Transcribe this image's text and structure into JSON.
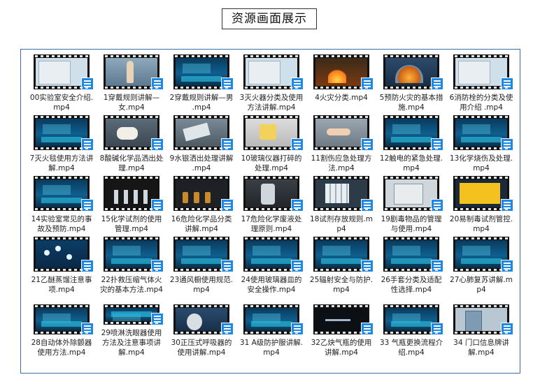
{
  "page": {
    "title": "资源画面展示"
  },
  "colors": {
    "badge": "#1e88e5",
    "window_border": "#3b6ea5"
  },
  "badge_icon": "playlist-icon",
  "files": [
    {
      "name": "00实验室安全介绍.mp4",
      "scene": "board"
    },
    {
      "name": "1穿戴规则讲解—女.mp4",
      "scene": "person"
    },
    {
      "name": "2穿戴规则讲解—男 .mp4",
      "scene": "lab"
    },
    {
      "name": "3灭火器分类及使用方法讲解.mp4",
      "scene": "board"
    },
    {
      "name": "4火灾分类.mp4",
      "scene": "fire"
    },
    {
      "name": "5预防火灾的基本措施.mp4",
      "scene": "dome"
    },
    {
      "name": "6消防栓的分类及使用介绍 .mp4",
      "scene": "board"
    },
    {
      "name": "7灭火毯使用方法讲解.mp4",
      "scene": "lab"
    },
    {
      "name": "8酸碱化学品洒出处理.mp4",
      "scene": "hand"
    },
    {
      "name": "9水银洒出处理讲解 .mp4",
      "scene": "spill"
    },
    {
      "name": "10玻璃仪器打碎的处理.mp4",
      "scene": "tube"
    },
    {
      "name": "11割伤应急处理方法.mp4",
      "scene": "cut"
    },
    {
      "name": "12触电的紧急处理.mp4",
      "scene": "lab"
    },
    {
      "name": "13化学烧伤及处理.mp4",
      "scene": "lab"
    },
    {
      "name": "14实验室常见的事故及预防.mp4",
      "scene": "lab"
    },
    {
      "name": "15化学试剂的使用管理.mp4",
      "scene": "stand"
    },
    {
      "name": "16危险化学品分类讲解.mp4",
      "scene": "bottle"
    },
    {
      "name": "17危险化学废液处理原则.mp4",
      "scene": "can"
    },
    {
      "name": "18试剂存放规则.mp4",
      "scene": "rack"
    },
    {
      "name": "19剧毒物品的管理与使用.mp4",
      "scene": "safe"
    },
    {
      "name": "20易制毒试剂管控.mp4",
      "scene": "yellow"
    },
    {
      "name": "21乙醚蒸馏注意事项.mp4",
      "scene": "molecule"
    },
    {
      "name": "22扑救压缩气体火灾的基本方法.mp4",
      "scene": "lab"
    },
    {
      "name": "23通风橱使用规范.mp4",
      "scene": "lab"
    },
    {
      "name": "24使用玻璃器皿的安全操作.mp4",
      "scene": "lab"
    },
    {
      "name": "25辐射安全与防护.mp4",
      "scene": "lab"
    },
    {
      "name": "26手套分类及适配性选择.mp4",
      "scene": "lab"
    },
    {
      "name": "27心肺复苏讲解.mp4",
      "scene": "lab"
    },
    {
      "name": "28自动体外除颤器使用方法.mp4",
      "scene": "lab"
    },
    {
      "name": "29喷淋洗眼器使用方法及注意事项讲解.mp4",
      "scene": "lab"
    },
    {
      "name": "30正压式呼吸器的使用讲解.mp4",
      "scene": "mask"
    },
    {
      "name": "31 A级防护服讲解.mp4",
      "scene": "lab"
    },
    {
      "name": "32乙炔气瓶的使用讲解.mp4",
      "scene": "screen"
    },
    {
      "name": "33 气瓶更换流程介绍.mp4",
      "scene": "lab"
    },
    {
      "name": "34 门口信息牌讲解.mp4",
      "scene": "door"
    }
  ]
}
